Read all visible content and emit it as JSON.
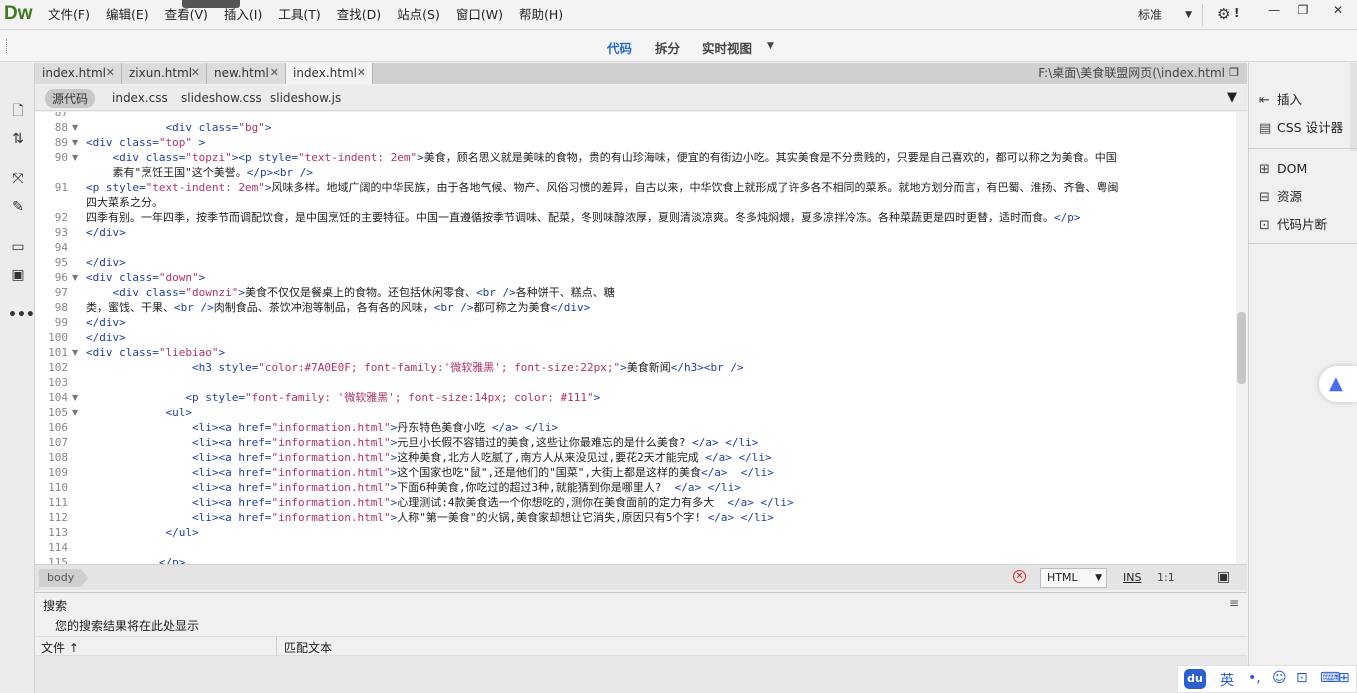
{
  "app": {
    "logo": "Dw"
  },
  "menu": {
    "items": [
      "文件(F)",
      "编辑(E)",
      "查看(V)",
      "插入(I)",
      "工具(T)",
      "查找(D)",
      "站点(S)",
      "窗口(W)",
      "帮助(H)"
    ],
    "layout": "标准"
  },
  "window_controls": {
    "minimize": "—",
    "restore": "❐",
    "close": "✕"
  },
  "view_toolbar": {
    "code": "代码",
    "split": "拆分",
    "live": "实时视图"
  },
  "doc_tabs": [
    {
      "label": "index.html"
    },
    {
      "label": "zixun.html"
    },
    {
      "label": "new.html"
    },
    {
      "label": "index.html"
    }
  ],
  "file_path": "F:\\桌面\\美食联盟网页(\\index.html",
  "related_files": [
    "源代码",
    "index.css",
    "slideshow.css",
    "slideshow.js"
  ],
  "code": {
    "lines": [
      {
        "n": "87",
        "fold": false,
        "indent": "",
        "text": ""
      },
      {
        "n": "88",
        "fold": true,
        "indent": "            ",
        "text": "<div class=\"bg\">"
      },
      {
        "n": "89",
        "fold": true,
        "indent": "",
        "text": "<div class=\"top\" >"
      },
      {
        "n": "90",
        "fold": true,
        "indent": "    ",
        "text": "<div class=\"topzi\"><p style=\"text-indent: 2em\">美食，顾名思义就是美味的食物，贵的有山珍海味，便宜的有街边小吃。其实美食是不分贵贱的，只要是自己喜欢的，都可以称之为美食。中国"
      },
      {
        "n": "",
        "fold": false,
        "indent": "    ",
        "text": "素有\"烹饪王国\"这个美誉。</p><br />"
      },
      {
        "n": "91",
        "fold": false,
        "indent": "",
        "text": "<p style=\"text-indent: 2em\">风味多样。地域广阔的中华民族，由于各地气候、物产、风俗习惯的差异，自古以来，中华饮食上就形成了许多各不相同的菜系。就地方划分而言，有巴蜀、淮扬、齐鲁、粤闽"
      },
      {
        "n": "",
        "fold": false,
        "indent": "",
        "text": "四大菜系之分。"
      },
      {
        "n": "92",
        "fold": false,
        "indent": "",
        "text": "四季有别。一年四季，按季节而调配饮食，是中国烹饪的主要特征。中国一直遵循按季节调味、配菜，冬则味醇浓厚，夏则清淡凉爽。冬多炖焖煨，夏多凉拌冷冻。各种菜蔬更是四时更替，适时而食。</p>"
      },
      {
        "n": "93",
        "fold": false,
        "indent": "",
        "text": "</div>"
      },
      {
        "n": "94",
        "fold": false,
        "indent": "",
        "text": ""
      },
      {
        "n": "95",
        "fold": false,
        "indent": "",
        "text": "</div>"
      },
      {
        "n": "96",
        "fold": true,
        "indent": "",
        "text": "<div class=\"down\">"
      },
      {
        "n": "97",
        "fold": false,
        "indent": "    ",
        "text": "<div class=\"downzi\">美食不仅仅是餐桌上的食物。还包括休闲零食、<br />各种饼干、糕点、糖"
      },
      {
        "n": "98",
        "fold": false,
        "indent": "",
        "text": "类，蜜饯、干果、<br />肉制食品、茶饮冲泡等制品，各有各的风味，<br />都可称之为美食</div>"
      },
      {
        "n": "99",
        "fold": false,
        "indent": "",
        "text": "</div>"
      },
      {
        "n": "100",
        "fold": false,
        "indent": "",
        "text": "</div>"
      },
      {
        "n": "101",
        "fold": true,
        "indent": "",
        "text": "<div class=\"liebiao\">"
      },
      {
        "n": "102",
        "fold": false,
        "indent": "                ",
        "text": "<h3 style=\"color:#7A0E0F; font-family:'微软雅黑'; font-size:22px;\">美食新闻</h3><br />"
      },
      {
        "n": "103",
        "fold": false,
        "indent": "",
        "text": ""
      },
      {
        "n": "104",
        "fold": true,
        "indent": "               ",
        "text": "<p style=\"font-family: '微软雅黑'; font-size:14px; color: #111\">"
      },
      {
        "n": "105",
        "fold": true,
        "indent": "            ",
        "text": "<ul>"
      },
      {
        "n": "106",
        "fold": false,
        "indent": "                ",
        "text": "<li><a href=\"information.html\">丹东特色美食小吃 </a> </li>"
      },
      {
        "n": "107",
        "fold": false,
        "indent": "                ",
        "text": "<li><a href=\"information.html\">元旦小长假不容错过的美食,这些让你最难忘的是什么美食? </a> </li>"
      },
      {
        "n": "108",
        "fold": false,
        "indent": "                ",
        "text": "<li><a href=\"information.html\">这种美食,北方人吃腻了,南方人从来没见过,要花2天才能完成 </a> </li>"
      },
      {
        "n": "109",
        "fold": false,
        "indent": "                ",
        "text": "<li><a href=\"information.html\">这个国家也吃\"鼠\",还是他们的\"国菜\",大街上都是这样的美食</a>  </li>"
      },
      {
        "n": "110",
        "fold": false,
        "indent": "                ",
        "text": "<li><a href=\"information.html\">下面6种美食,你吃过的超过3种,就能猜到你是哪里人?  </a> </li>"
      },
      {
        "n": "111",
        "fold": false,
        "indent": "                ",
        "text": "<li><a href=\"information.html\">心理测试:4款美食选一个你想吃的,测你在美食面前的定力有多大  </a> </li>"
      },
      {
        "n": "112",
        "fold": false,
        "indent": "                ",
        "text": "<li><a href=\"information.html\">人称\"第一美食\"的火锅,美食家却想让它消失,原因只有5个字! </a> </li>"
      },
      {
        "n": "113",
        "fold": false,
        "indent": "            ",
        "text": "</ul>"
      },
      {
        "n": "114",
        "fold": false,
        "indent": "",
        "text": ""
      },
      {
        "n": "115",
        "fold": false,
        "indent": "           ",
        "text": "</p>"
      }
    ]
  },
  "status": {
    "tag": "body",
    "error": "×",
    "language": "HTML",
    "mode": "INS",
    "position": "1:1"
  },
  "search": {
    "title": "搜索",
    "empty_message": "您的搜索结果将在此处显示",
    "col_file": "文件 ↑",
    "col_match": "匹配文本"
  },
  "right_panel": {
    "group1": [
      "插入",
      "CSS 设计器"
    ],
    "group2": [
      "DOM",
      "资源",
      "代码片断"
    ]
  },
  "ime": {
    "logo": "du",
    "lang": "英"
  },
  "colors": {
    "accent": "#2c6bc9",
    "logo_green": "#3f7a1f",
    "tag_blue": "#1f3f9d",
    "value_pink": "#b2306b",
    "error_red": "#d83030"
  }
}
